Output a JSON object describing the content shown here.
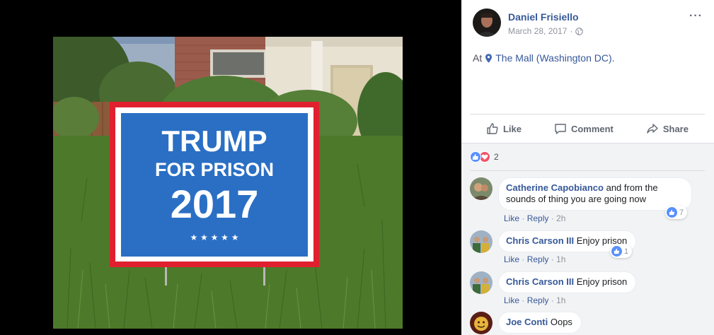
{
  "sign": {
    "line1": "TRUMP",
    "line2": "FOR PRISON",
    "line3": "2017",
    "stars": "★ ★ ★ ★ ★"
  },
  "post": {
    "author": "Daniel Frisiello",
    "date": "March 28, 2017",
    "separator": "·",
    "more": "···",
    "location_prefix": "At",
    "location_name": "The Mall (Washington DC).",
    "reaction_count": "2"
  },
  "actions": {
    "like": "Like",
    "comment": "Comment",
    "share": "Share"
  },
  "comments": [
    {
      "name": "Catherine Capobianco",
      "text": "and from the sounds of thing you are going now",
      "like": "Like",
      "reply": "Reply",
      "time": "2h",
      "reaction_count": "7"
    },
    {
      "name": "Chris Carson III",
      "text": "Enjoy prison",
      "like": "Like",
      "reply": "Reply",
      "time": "1h",
      "reaction_count": "1"
    },
    {
      "name": "Chris Carson III",
      "text": "Enjoy prison",
      "like": "Like",
      "reply": "Reply",
      "time": "1h"
    },
    {
      "name": "Joe Conti",
      "text": "Oops"
    }
  ],
  "colors": {
    "link_blue": "#365899",
    "sign_blue": "#2a6fc4",
    "sign_red": "#e0202f",
    "like_blue": "#5890ff",
    "love_red": "#f25268"
  }
}
